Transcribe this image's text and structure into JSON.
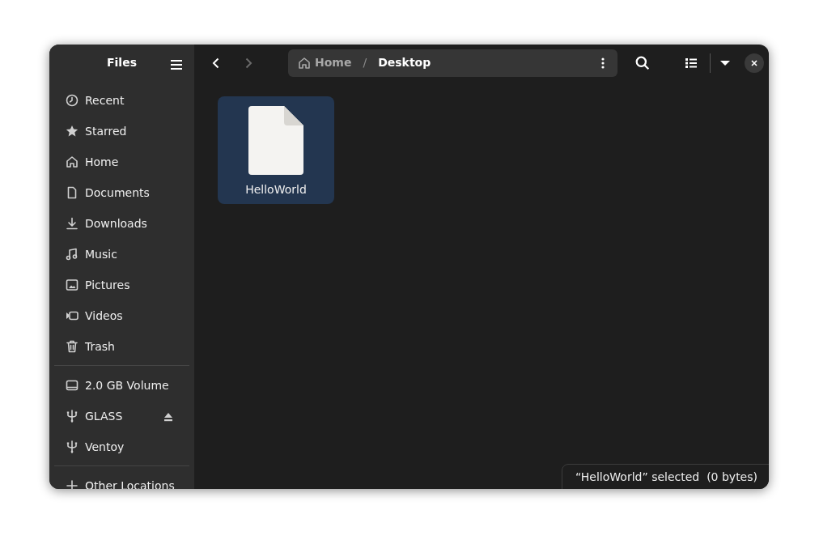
{
  "sidebar": {
    "title": "Files",
    "sections": [
      {
        "items": [
          {
            "label": "Recent"
          },
          {
            "label": "Starred"
          },
          {
            "label": "Home"
          },
          {
            "label": "Documents"
          },
          {
            "label": "Downloads"
          },
          {
            "label": "Music"
          },
          {
            "label": "Pictures"
          },
          {
            "label": "Videos"
          },
          {
            "label": "Trash"
          }
        ]
      },
      {
        "items": [
          {
            "label": "2.0 GB Volume",
            "ejectable": false
          },
          {
            "label": "GLASS",
            "ejectable": true
          },
          {
            "label": "Ventoy",
            "ejectable": false
          }
        ]
      },
      {
        "items": [
          {
            "label": "Other Locations"
          }
        ]
      }
    ]
  },
  "navigation": {
    "back_disabled": false,
    "forward_disabled": true
  },
  "path": [
    {
      "label": "Home",
      "current": false
    },
    {
      "label": "Desktop",
      "current": true
    }
  ],
  "path_separator": "/",
  "files": [
    {
      "name": "HelloWorld",
      "selected": true
    }
  ],
  "status": "“HelloWorld” selected  (0 bytes)"
}
